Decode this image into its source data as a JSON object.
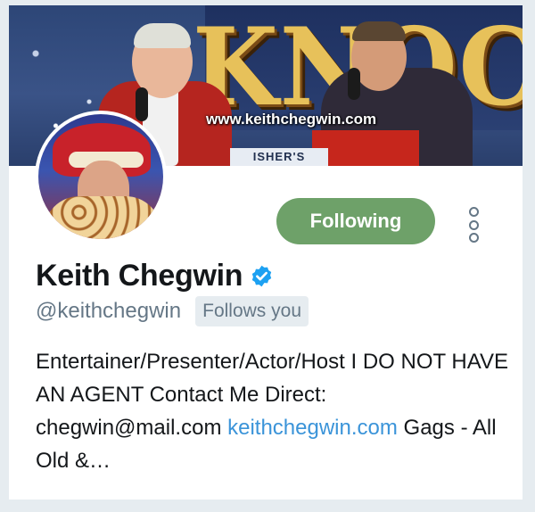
{
  "banner": {
    "watermark": "www.keithchegwin.com",
    "sign_text": "KNOCK",
    "sticker_text": "ISHER'S"
  },
  "profile": {
    "display_name": "Keith Chegwin",
    "handle": "@keithchegwin",
    "follows_you": "Follows you",
    "verified_icon": "verified-badge-icon",
    "verified_color": "#1da1f2"
  },
  "actions": {
    "following_label": "Following",
    "following_color": "#6ea169",
    "more_icon": "more-vertical-icon"
  },
  "bio": {
    "text": "Entertainer/Presenter/Actor/Host I DO NOT HAVE AN AGENT Contact Me Direct: chegwin@mail.com",
    "link_text": "keithchegwin.com",
    "tail": " Gags - All Old &…",
    "link_color": "#3b94d9"
  }
}
